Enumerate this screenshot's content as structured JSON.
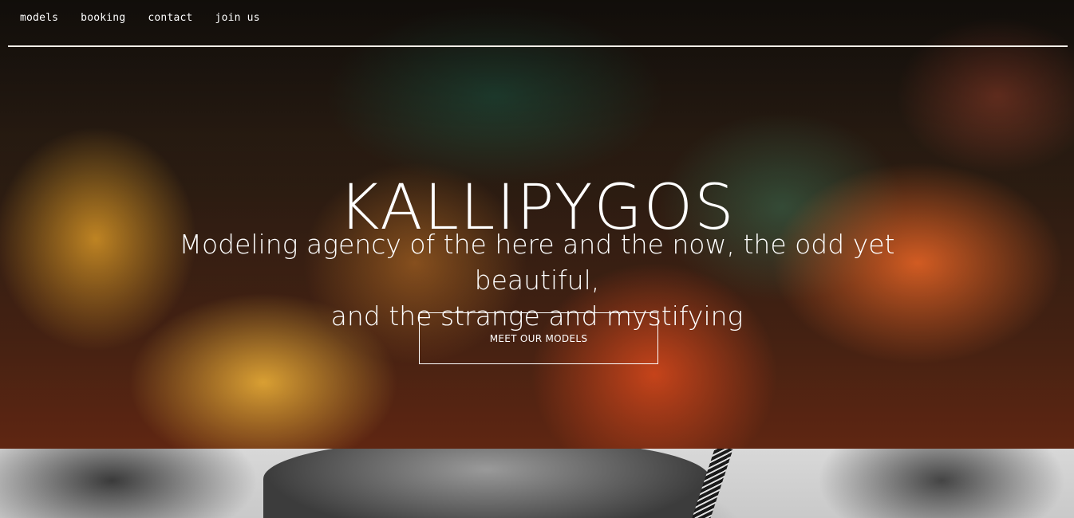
{
  "nav": {
    "items": [
      {
        "label": "models"
      },
      {
        "label": "booking"
      },
      {
        "label": "contact"
      },
      {
        "label": "join us"
      }
    ]
  },
  "hero": {
    "title": "KALLIPYGOS",
    "tagline_line1": "Modeling agency of the here and the now, the odd yet beautiful,",
    "tagline_line2": "and the strange and mystifying",
    "cta_label": "MEET OUR MODELS"
  },
  "colors": {
    "text": "#ffffff",
    "nav_rule": "#f2eee8"
  }
}
